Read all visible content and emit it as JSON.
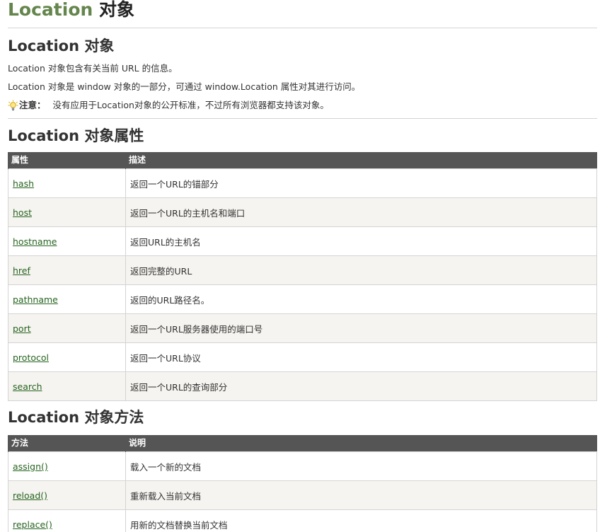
{
  "page": {
    "title_accent": "Location",
    "title_rest": " 对象"
  },
  "section1": {
    "heading": "Location 对象",
    "para1": "Location 对象包含有关当前 URL 的信息。",
    "para2": "Location 对象是 window 对象的一部分，可通过 window.Location 属性对其进行访问。",
    "note_label": "注意：",
    "note_text": "没有应用于Location对象的公开标准，不过所有浏览器都支持该对象。",
    "note_icon": "lightbulb-icon"
  },
  "properties": {
    "heading": "Location 对象属性",
    "headers": [
      "属性",
      "描述"
    ],
    "rows": [
      {
        "name": "hash",
        "desc": "返回一个URL的锚部分"
      },
      {
        "name": "host",
        "desc": "返回一个URL的主机名和端口"
      },
      {
        "name": "hostname",
        "desc": "返回URL的主机名"
      },
      {
        "name": "href",
        "desc": "返回完整的URL"
      },
      {
        "name": "pathname",
        "desc": "返回的URL路径名。"
      },
      {
        "name": "port",
        "desc": "返回一个URL服务器使用的端口号"
      },
      {
        "name": "protocol",
        "desc": "返回一个URL协议"
      },
      {
        "name": "search",
        "desc": "返回一个URL的查询部分"
      }
    ]
  },
  "methods": {
    "heading": "Location 对象方法",
    "headers": [
      "方法",
      "说明"
    ],
    "rows": [
      {
        "name": "assign()",
        "desc": "载入一个新的文档"
      },
      {
        "name": "reload()",
        "desc": "重新载入当前文档"
      },
      {
        "name": "replace()",
        "desc": "用新的文档替换当前文档"
      }
    ]
  },
  "colors": {
    "accent": "#64854c",
    "link": "#26641f",
    "header_bg": "#555555",
    "alt_row_bg": "#f6f4f0"
  }
}
